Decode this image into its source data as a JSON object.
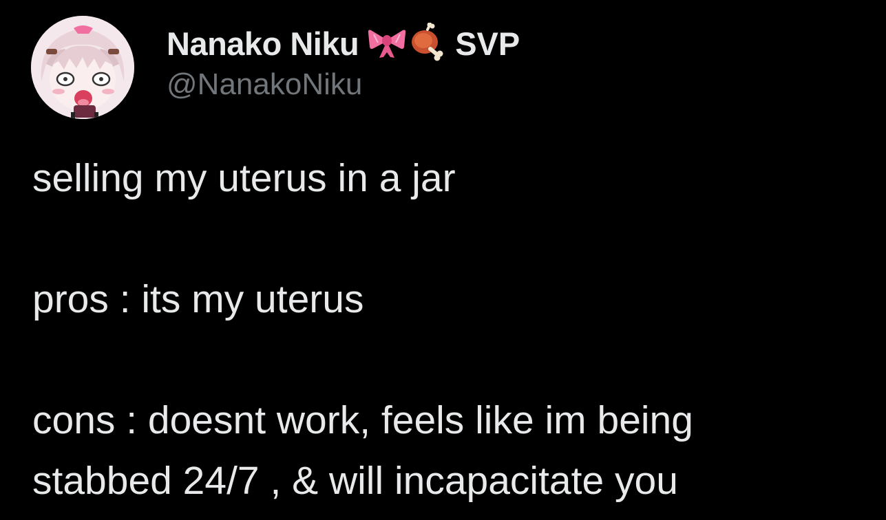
{
  "tweet": {
    "author": {
      "display_name": "Nanako Niku",
      "name_emojis": [
        "ribbon-emoji",
        "meat-on-bone-emoji"
      ],
      "name_suffix": "SVP",
      "handle": "@NanakoNiku",
      "avatar": "anime-girl-avatar"
    },
    "text": {
      "line1": "selling my uterus in a jar",
      "line2": "pros : its my uterus",
      "line3": "cons : doesnt work, feels like im being",
      "line4": "stabbed 24/7 , & will incapacitate you"
    }
  },
  "colors": {
    "background": "#000000",
    "primary_text": "#e7e9ea",
    "secondary_text": "#71767b",
    "ribbon": "#f06fa0",
    "meat": "#c8502e"
  }
}
